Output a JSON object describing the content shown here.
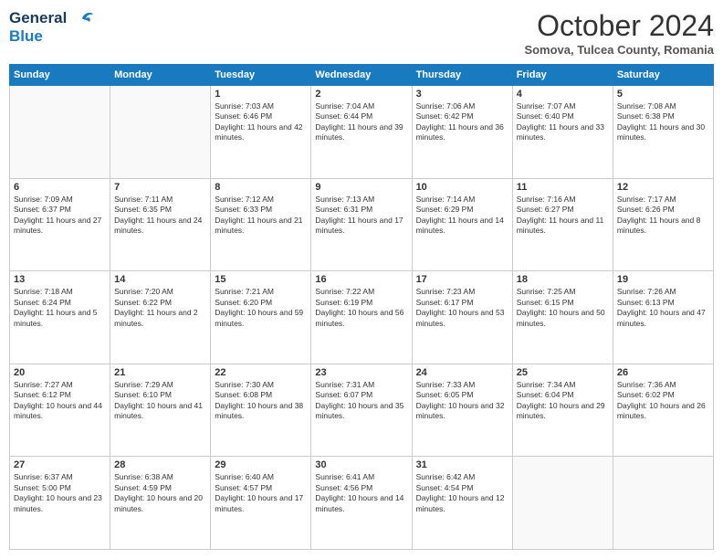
{
  "header": {
    "logo_line1": "General",
    "logo_line2": "Blue",
    "month": "October 2024",
    "location": "Somova, Tulcea County, Romania"
  },
  "days_of_week": [
    "Sunday",
    "Monday",
    "Tuesday",
    "Wednesday",
    "Thursday",
    "Friday",
    "Saturday"
  ],
  "weeks": [
    [
      {
        "day": "",
        "text": ""
      },
      {
        "day": "",
        "text": ""
      },
      {
        "day": "1",
        "text": "Sunrise: 7:03 AM\nSunset: 6:46 PM\nDaylight: 11 hours and 42 minutes."
      },
      {
        "day": "2",
        "text": "Sunrise: 7:04 AM\nSunset: 6:44 PM\nDaylight: 11 hours and 39 minutes."
      },
      {
        "day": "3",
        "text": "Sunrise: 7:06 AM\nSunset: 6:42 PM\nDaylight: 11 hours and 36 minutes."
      },
      {
        "day": "4",
        "text": "Sunrise: 7:07 AM\nSunset: 6:40 PM\nDaylight: 11 hours and 33 minutes."
      },
      {
        "day": "5",
        "text": "Sunrise: 7:08 AM\nSunset: 6:38 PM\nDaylight: 11 hours and 30 minutes."
      }
    ],
    [
      {
        "day": "6",
        "text": "Sunrise: 7:09 AM\nSunset: 6:37 PM\nDaylight: 11 hours and 27 minutes."
      },
      {
        "day": "7",
        "text": "Sunrise: 7:11 AM\nSunset: 6:35 PM\nDaylight: 11 hours and 24 minutes."
      },
      {
        "day": "8",
        "text": "Sunrise: 7:12 AM\nSunset: 6:33 PM\nDaylight: 11 hours and 21 minutes."
      },
      {
        "day": "9",
        "text": "Sunrise: 7:13 AM\nSunset: 6:31 PM\nDaylight: 11 hours and 17 minutes."
      },
      {
        "day": "10",
        "text": "Sunrise: 7:14 AM\nSunset: 6:29 PM\nDaylight: 11 hours and 14 minutes."
      },
      {
        "day": "11",
        "text": "Sunrise: 7:16 AM\nSunset: 6:27 PM\nDaylight: 11 hours and 11 minutes."
      },
      {
        "day": "12",
        "text": "Sunrise: 7:17 AM\nSunset: 6:26 PM\nDaylight: 11 hours and 8 minutes."
      }
    ],
    [
      {
        "day": "13",
        "text": "Sunrise: 7:18 AM\nSunset: 6:24 PM\nDaylight: 11 hours and 5 minutes."
      },
      {
        "day": "14",
        "text": "Sunrise: 7:20 AM\nSunset: 6:22 PM\nDaylight: 11 hours and 2 minutes."
      },
      {
        "day": "15",
        "text": "Sunrise: 7:21 AM\nSunset: 6:20 PM\nDaylight: 10 hours and 59 minutes."
      },
      {
        "day": "16",
        "text": "Sunrise: 7:22 AM\nSunset: 6:19 PM\nDaylight: 10 hours and 56 minutes."
      },
      {
        "day": "17",
        "text": "Sunrise: 7:23 AM\nSunset: 6:17 PM\nDaylight: 10 hours and 53 minutes."
      },
      {
        "day": "18",
        "text": "Sunrise: 7:25 AM\nSunset: 6:15 PM\nDaylight: 10 hours and 50 minutes."
      },
      {
        "day": "19",
        "text": "Sunrise: 7:26 AM\nSunset: 6:13 PM\nDaylight: 10 hours and 47 minutes."
      }
    ],
    [
      {
        "day": "20",
        "text": "Sunrise: 7:27 AM\nSunset: 6:12 PM\nDaylight: 10 hours and 44 minutes."
      },
      {
        "day": "21",
        "text": "Sunrise: 7:29 AM\nSunset: 6:10 PM\nDaylight: 10 hours and 41 minutes."
      },
      {
        "day": "22",
        "text": "Sunrise: 7:30 AM\nSunset: 6:08 PM\nDaylight: 10 hours and 38 minutes."
      },
      {
        "day": "23",
        "text": "Sunrise: 7:31 AM\nSunset: 6:07 PM\nDaylight: 10 hours and 35 minutes."
      },
      {
        "day": "24",
        "text": "Sunrise: 7:33 AM\nSunset: 6:05 PM\nDaylight: 10 hours and 32 minutes."
      },
      {
        "day": "25",
        "text": "Sunrise: 7:34 AM\nSunset: 6:04 PM\nDaylight: 10 hours and 29 minutes."
      },
      {
        "day": "26",
        "text": "Sunrise: 7:36 AM\nSunset: 6:02 PM\nDaylight: 10 hours and 26 minutes."
      }
    ],
    [
      {
        "day": "27",
        "text": "Sunrise: 6:37 AM\nSunset: 5:00 PM\nDaylight: 10 hours and 23 minutes."
      },
      {
        "day": "28",
        "text": "Sunrise: 6:38 AM\nSunset: 4:59 PM\nDaylight: 10 hours and 20 minutes."
      },
      {
        "day": "29",
        "text": "Sunrise: 6:40 AM\nSunset: 4:57 PM\nDaylight: 10 hours and 17 minutes."
      },
      {
        "day": "30",
        "text": "Sunrise: 6:41 AM\nSunset: 4:56 PM\nDaylight: 10 hours and 14 minutes."
      },
      {
        "day": "31",
        "text": "Sunrise: 6:42 AM\nSunset: 4:54 PM\nDaylight: 10 hours and 12 minutes."
      },
      {
        "day": "",
        "text": ""
      },
      {
        "day": "",
        "text": ""
      }
    ]
  ]
}
